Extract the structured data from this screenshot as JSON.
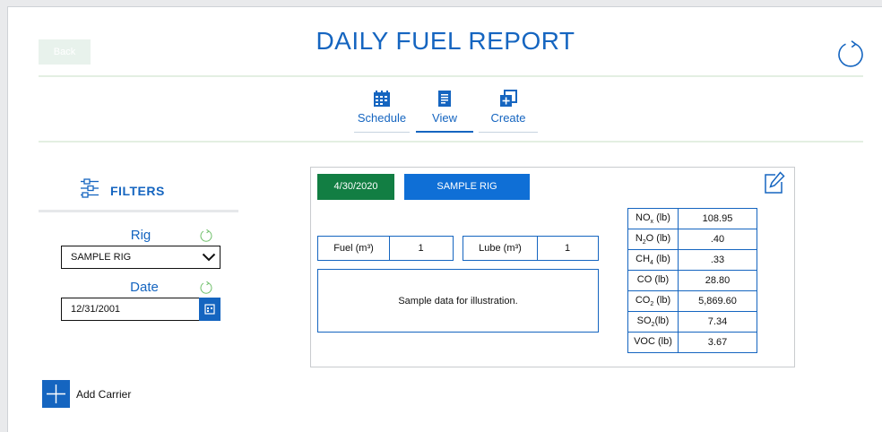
{
  "header": {
    "back_label": "Back",
    "title": "DAILY FUEL REPORT"
  },
  "nav": [
    {
      "label": "Schedule",
      "icon": "calendar-grid-icon",
      "active": false
    },
    {
      "label": "View",
      "icon": "document-icon",
      "active": true
    },
    {
      "label": "Create",
      "icon": "add-copy-icon",
      "active": false
    }
  ],
  "filters": {
    "title": "FILTERS",
    "rig_label": "Rig",
    "rig_value": "SAMPLE RIG",
    "date_label": "Date",
    "date_value": "12/31/2001"
  },
  "add_carrier_label": "Add Carrier",
  "report": {
    "date": "4/30/2020",
    "rig": "SAMPLE RIG",
    "fuel_label": "Fuel (m³)",
    "fuel_value": "1",
    "lube_label": "Lube (m³)",
    "lube_value": "1",
    "note": "Sample data for illustration.",
    "emissions": [
      {
        "base": "NO",
        "sub": "x",
        "suffix": " (lb)",
        "value": "108.95"
      },
      {
        "base": "N",
        "sub": "2",
        "suffix": "O (lb)",
        "value": ".40"
      },
      {
        "base": "CH",
        "sub": "4",
        "suffix": " (lb)",
        "value": ".33"
      },
      {
        "base": "CO",
        "sub": "",
        "suffix": " (lb)",
        "value": "28.80"
      },
      {
        "base": "CO",
        "sub": "2",
        "suffix": " (lb)",
        "value": "5,869.60"
      },
      {
        "base": "SO",
        "sub": "2",
        "suffix": "(lb)",
        "value": "7.34"
      },
      {
        "base": "VOC",
        "sub": "",
        "suffix": " (lb)",
        "value": "3.67"
      }
    ]
  },
  "colors": {
    "primary": "#1565c0",
    "date_badge": "#127e43",
    "rig_badge": "#0f6fd6"
  }
}
